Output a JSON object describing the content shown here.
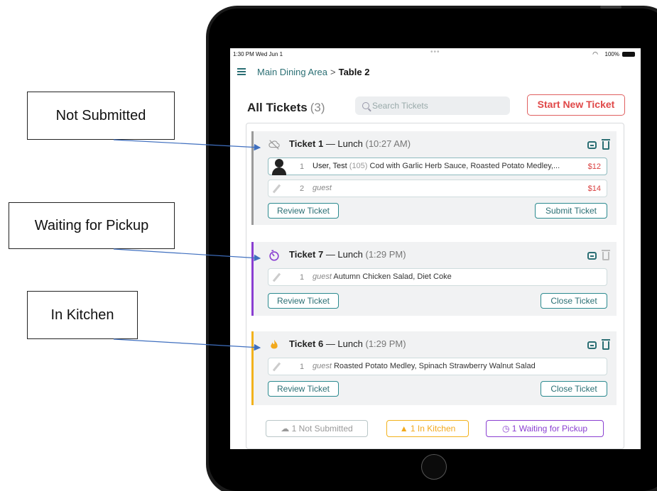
{
  "annotations": {
    "not_submitted": "Not Submitted",
    "waiting": "Waiting for Pickup",
    "in_kitchen": "In Kitchen"
  },
  "statusbar": {
    "time": "1:30 PM  Wed Jun 1",
    "dots": "•••",
    "battery": "100%"
  },
  "nav": {
    "area": "Main Dining Area",
    "separator": ">",
    "table": "Table 2"
  },
  "header": {
    "title": "All Tickets",
    "count": "(3)",
    "search_placeholder": "Search Tickets",
    "start_button": "Start New Ticket"
  },
  "colors": {
    "teal": "#2b6f74",
    "red": "#e04848",
    "purple": "#8a3fd1",
    "orange": "#f2b21c",
    "gray": "#999999"
  },
  "tickets": [
    {
      "status": "not-submitted",
      "status_icon": "cloud-off-icon",
      "name": "Ticket 1",
      "meal": "— Lunch",
      "time": "(10:27 AM)",
      "rows": [
        {
          "num": "1",
          "person": "User, Test",
          "person_id": "(105)",
          "items": "Cod with Garlic Herb Sauce, Roasted Potato Medley,...",
          "price": "$12"
        },
        {
          "num": "2",
          "person": "guest",
          "items": "",
          "price": "$14"
        }
      ],
      "left_button": "Review Ticket",
      "right_button": "Submit Ticket"
    },
    {
      "status": "waiting-for-pickup",
      "status_icon": "timer-icon",
      "name": "Ticket 7",
      "meal": "— Lunch",
      "time": "(1:29 PM)",
      "rows": [
        {
          "num": "1",
          "person": "guest",
          "items": "Autumn Chicken Salad, Diet Coke"
        }
      ],
      "left_button": "Review Ticket",
      "right_button": "Close Ticket"
    },
    {
      "status": "in-kitchen",
      "status_icon": "flame-icon",
      "name": "Ticket 6",
      "meal": "— Lunch",
      "time": "(1:29 PM)",
      "rows": [
        {
          "num": "1",
          "person": "guest",
          "items": "Roasted Potato Medley, Spinach Strawberry Walnut Salad"
        }
      ],
      "left_button": "Review Ticket",
      "right_button": "Close Ticket"
    }
  ],
  "footer": {
    "not_submitted": "1 Not Submitted",
    "in_kitchen": "1 In Kitchen",
    "waiting": "1 Waiting for Pickup"
  }
}
